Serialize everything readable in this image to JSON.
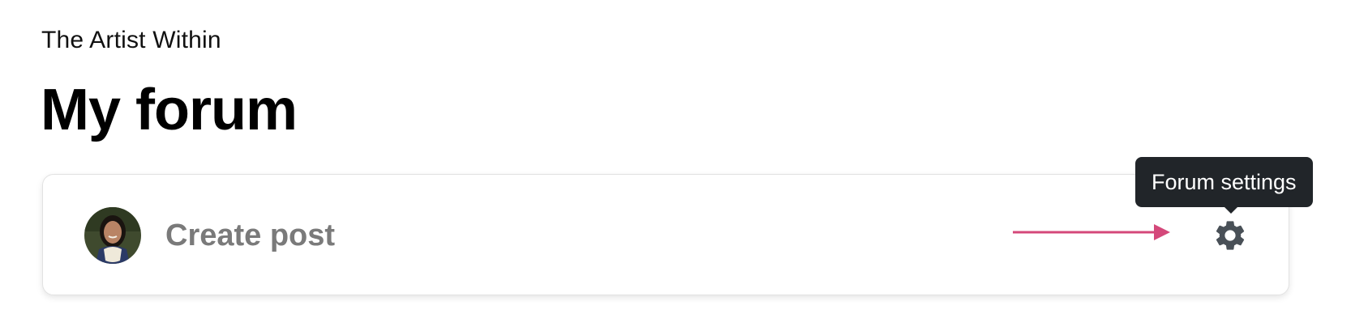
{
  "header": {
    "subtitle": "The Artist Within",
    "title": "My forum"
  },
  "composer": {
    "avatar": "user-avatar-photo",
    "placeholder": "Create post",
    "settings_icon": "gear-icon",
    "annotation_arrow_color": "#d4487a"
  },
  "tooltip": {
    "text": "Forum settings"
  }
}
